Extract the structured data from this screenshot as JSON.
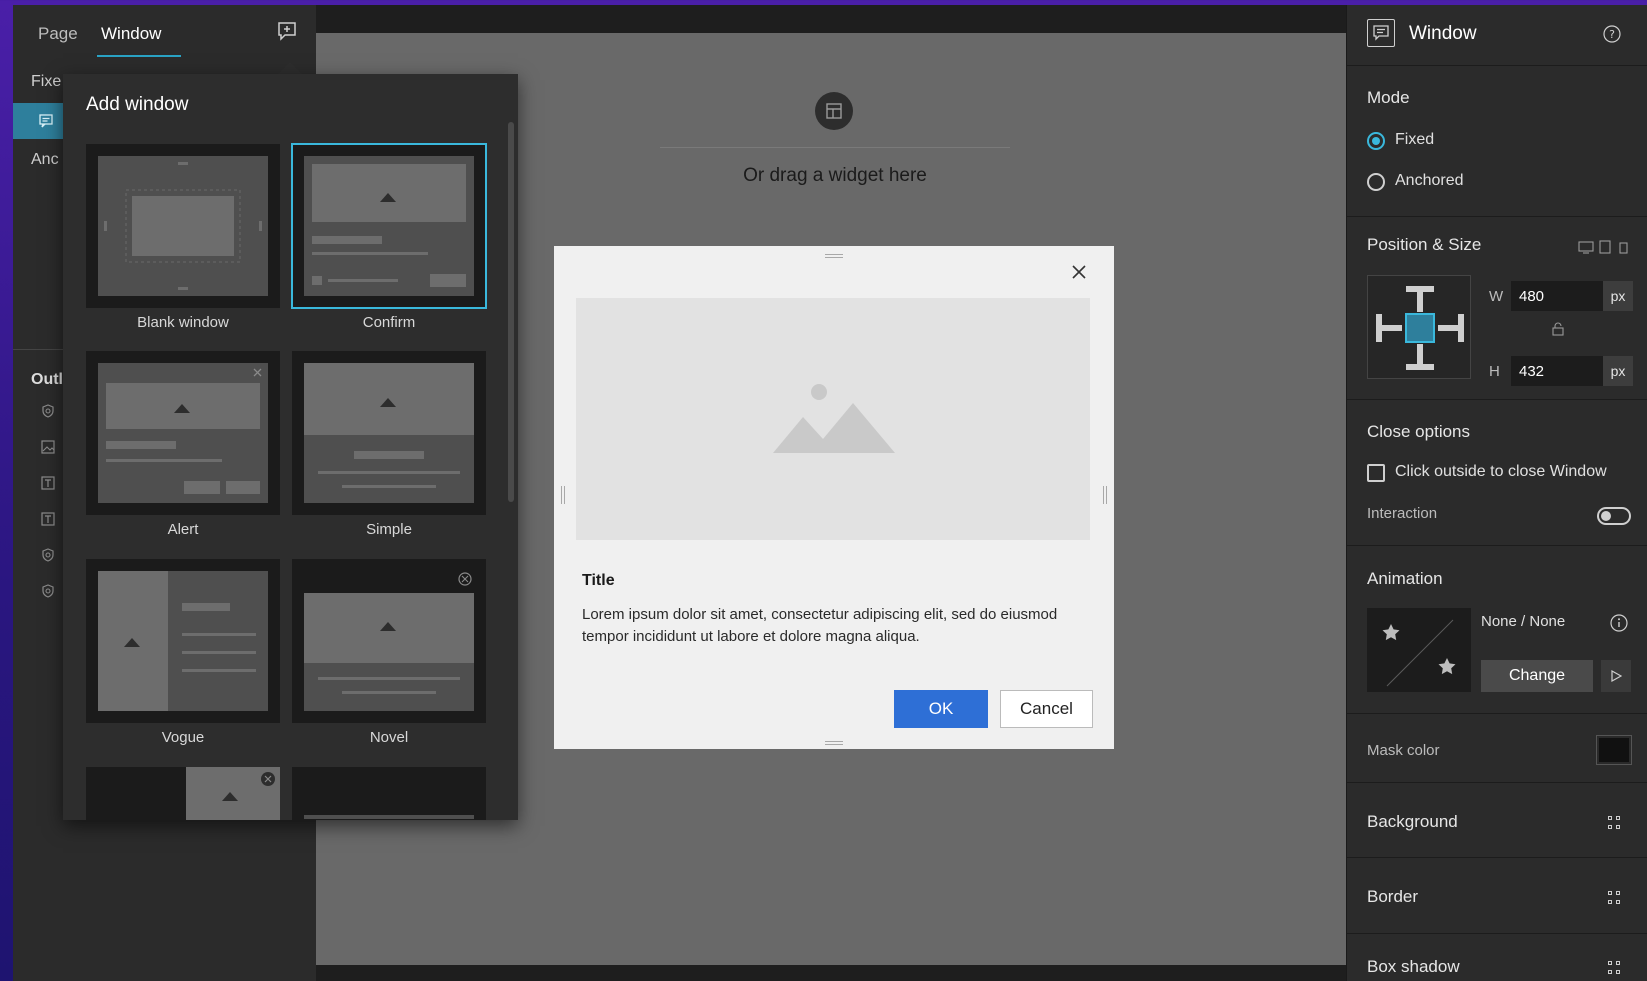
{
  "left_panel": {
    "tabs": [
      {
        "label": "Page",
        "active": false
      },
      {
        "label": "Window",
        "active": true
      }
    ],
    "rows": {
      "fixed_partial": "Fixe",
      "anchored_partial": "Anc",
      "outline_partial": "Outl"
    },
    "outline_icons": [
      "widget-icon",
      "image-icon",
      "text-icon",
      "text-icon",
      "widget-icon",
      "widget-icon"
    ]
  },
  "add_window": {
    "title": "Add window",
    "templates": [
      {
        "label": "Blank window",
        "selected": false
      },
      {
        "label": "Confirm",
        "selected": true
      },
      {
        "label": "Alert",
        "selected": false
      },
      {
        "label": "Simple",
        "selected": false
      },
      {
        "label": "Vogue",
        "selected": false
      },
      {
        "label": "Novel",
        "selected": false
      }
    ]
  },
  "canvas": {
    "drag_hint": "Or drag a widget here"
  },
  "dialog": {
    "title": "Title",
    "body": "Lorem ipsum dolor sit amet, consectetur adipiscing elit, sed do eiusmod tempor incididunt ut labore et dolore magna aliqua.",
    "ok_label": "OK",
    "cancel_label": "Cancel",
    "accent": "#2e6fd6"
  },
  "right_panel": {
    "title": "Window",
    "mode": {
      "heading": "Mode",
      "options": [
        {
          "label": "Fixed",
          "selected": true
        },
        {
          "label": "Anchored",
          "selected": false
        }
      ]
    },
    "position_size": {
      "heading": "Position & Size",
      "w_label": "W",
      "w_value": "480",
      "w_unit": "px",
      "h_label": "H",
      "h_value": "432",
      "h_unit": "px"
    },
    "close_options": {
      "heading": "Close options",
      "click_outside_label": "Click outside to close Window",
      "click_outside_checked": false,
      "interaction_label": "Interaction",
      "interaction_on": false
    },
    "animation": {
      "heading": "Animation",
      "value": "None / None",
      "change_label": "Change"
    },
    "mask_color": {
      "label": "Mask color",
      "value": "#111111"
    },
    "background": {
      "heading": "Background"
    },
    "border": {
      "heading": "Border"
    },
    "box_shadow": {
      "heading": "Box shadow"
    }
  },
  "colors": {
    "accent_teal": "#3ab8dc",
    "panel_bg": "#2b2b2b",
    "canvas_bg": "#696969"
  }
}
